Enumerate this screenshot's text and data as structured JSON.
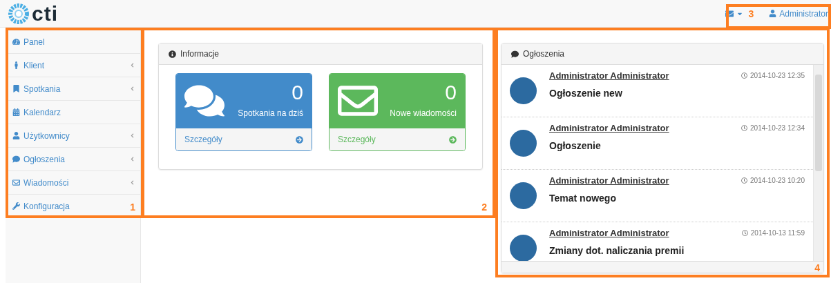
{
  "header": {
    "logo": "cti",
    "user": "Administrator"
  },
  "sidebar": {
    "items": [
      {
        "label": "Panel",
        "expandable": false
      },
      {
        "label": "Klient",
        "expandable": true
      },
      {
        "label": "Spotkania",
        "expandable": true
      },
      {
        "label": "Kalendarz",
        "expandable": false
      },
      {
        "label": "Użytkownicy",
        "expandable": true
      },
      {
        "label": "Ogłoszenia",
        "expandable": true
      },
      {
        "label": "Wiadomości",
        "expandable": true
      },
      {
        "label": "Konfiguracja",
        "expandable": false
      }
    ]
  },
  "info_panel": {
    "title": "Informacje",
    "tiles": [
      {
        "kind": "meetings",
        "color": "#428bca",
        "count": "0",
        "caption": "Spotkania na dziś",
        "link": "Szczegóły"
      },
      {
        "kind": "messages",
        "color": "#5cb85c",
        "count": "0",
        "caption": "Nowe wiadomości",
        "link": "Szczegóły"
      }
    ]
  },
  "announcements": {
    "title": "Ogłoszenia",
    "items": [
      {
        "author": "Administrator Administrator",
        "time": "2014-10-23 12:35",
        "title": "Ogłoszenie new"
      },
      {
        "author": "Administrator Administrator",
        "time": "2014-10-23 12:34",
        "title": "Ogłoszenie"
      },
      {
        "author": "Administrator Administrator",
        "time": "2014-10-23 10:20",
        "title": "Temat nowego"
      },
      {
        "author": "Administrator Administrator",
        "time": "2014-10-13 11:59",
        "title": "Zmiany dot. naliczania premii"
      }
    ]
  },
  "annotations": [
    {
      "label": "1"
    },
    {
      "label": "2"
    },
    {
      "label": "3"
    },
    {
      "label": "4"
    }
  ]
}
